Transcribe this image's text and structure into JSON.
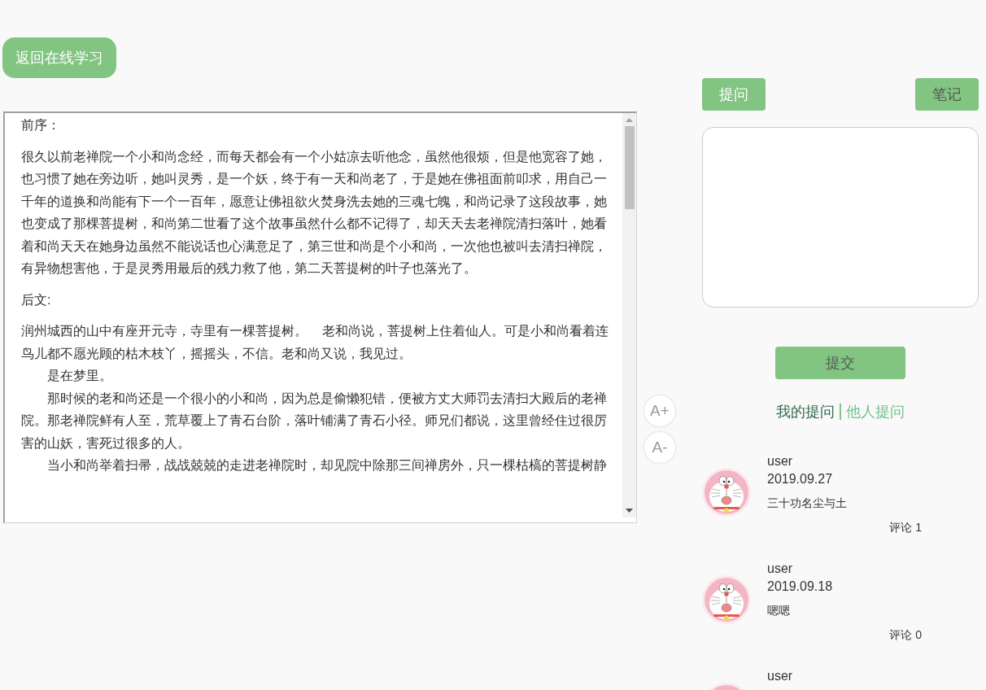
{
  "back_button": {
    "label": "返回在线学习"
  },
  "reader": {
    "passage": [
      {
        "lines": [
          "前序："
        ]
      },
      {
        "lines": [
          "很久以前老禅院一个小和尚念经，而每天都会有一个小姑凉去听他念，虽然他很烦，但是他宽容了她，也习惯了她在旁边听，她叫灵秀，是一个妖，终于有一天和尚老了，于是她在佛祖面前叩求，用自己一千年的道换和尚能有下一个一百年，愿意让佛祖欲火焚身洗去她的三魂七魄，和尚记录了这段故事，她也变成了那棵菩提树，和尚第二世看了这个故事虽然什么都不记得了，却天天去老禅院清扫落叶，她看着和尚天天在她身边虽然不能说话也心满意足了，第三世和尚是个小和尚，一次他也被叫去清扫禅院，有异物想害他，于是灵秀用最后的残力救了他，第二天菩提树的叶子也落光了。"
        ]
      },
      {
        "lines": [
          "后文:"
        ]
      },
      {
        "lines": [
          "润州城西的山中有座开元寺，寺里有一棵菩提树。    老和尚说，菩提树上住着仙人。可是小和尚看着连鸟儿都不愿光顾的枯木枝丫，摇摇头，不信。老和尚又说，我见过。",
          "　　是在梦里。",
          "　　那时候的老和尚还是一个很小的小和尚，因为总是偷懒犯错，便被方丈大师罚去清扫大殿后的老禅院。那老禅院鲜有人至，荒草覆上了青石台阶，落叶铺满了青石小径。师兄们都说，这里曾经住过很厉害的山妖，害死过很多的人。",
          "　　当小和尚举着扫帚，战战兢兢的走进老禅院时，却见院中除那三间禅房外，只一棵枯槁的菩提树静"
        ]
      }
    ],
    "font_buttons": [
      {
        "label": "A+"
      },
      {
        "label": "A-"
      }
    ]
  },
  "panel_tabs": [
    {
      "label": "提问",
      "selected": true
    },
    {
      "label": "笔记",
      "selected": false
    }
  ],
  "submit_button": {
    "label": "提交",
    "disabled": true
  },
  "question_filters": [
    {
      "label": "我的提问",
      "selected": true
    },
    {
      "label": "他人提问",
      "selected": false
    }
  ],
  "questions": [
    {
      "user": "user",
      "date": "2019.09.27",
      "content": "三十功名尘与土",
      "comments": "评论 1"
    },
    {
      "user": "user",
      "date": "2019.09.18",
      "content": "嗯嗯",
      "comments": "评论 0"
    },
    {
      "user": "user"
    }
  ]
}
